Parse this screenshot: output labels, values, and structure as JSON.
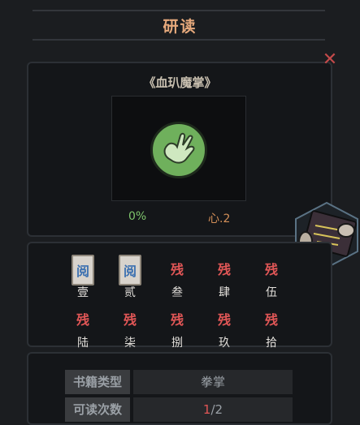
{
  "header": {
    "title": "研读"
  },
  "book": {
    "title": "《血玐魔掌》",
    "progress": "0%",
    "heart": "心.2"
  },
  "chapters": [
    {
      "label": "壹",
      "state": "read",
      "badge": "阅"
    },
    {
      "label": "贰",
      "state": "read",
      "badge": "阅"
    },
    {
      "label": "叁",
      "state": "fragment",
      "badge": "残"
    },
    {
      "label": "肆",
      "state": "fragment",
      "badge": "残"
    },
    {
      "label": "伍",
      "state": "fragment",
      "badge": "残"
    },
    {
      "label": "陆",
      "state": "fragment",
      "badge": "残"
    },
    {
      "label": "柒",
      "state": "fragment",
      "badge": "残"
    },
    {
      "label": "捌",
      "state": "fragment",
      "badge": "残"
    },
    {
      "label": "玖",
      "state": "fragment",
      "badge": "残"
    },
    {
      "label": "拾",
      "state": "fragment",
      "badge": "残"
    }
  ],
  "info": {
    "type_label": "书籍类型",
    "type_value": "拳掌",
    "count_label": "可读次数",
    "count_current": "1",
    "count_sep": "/",
    "count_total": "2"
  },
  "colors": {
    "accent": "#e6a97c",
    "progress": "#7fc56c",
    "fragment": "#e05656",
    "read": "#3a6fb0"
  },
  "icons": {
    "close": "close-icon",
    "book_art": "palm-strike-icon",
    "scroll_button": "scroll-read-icon"
  }
}
